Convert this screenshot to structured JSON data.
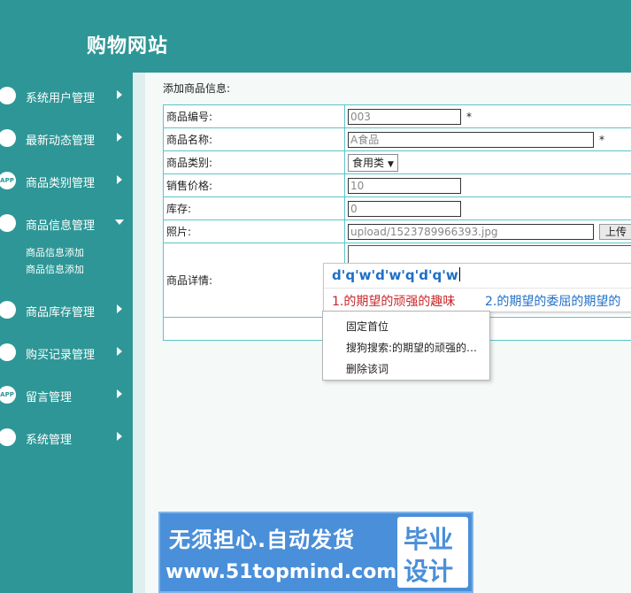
{
  "header": {
    "site_title": "购物网站"
  },
  "sidebar": {
    "items": [
      {
        "label": "系统用户管理",
        "icon": "monitor-icon",
        "icon_text": ""
      },
      {
        "label": "最新动态管理",
        "icon": "user-gear-icon",
        "icon_text": ""
      },
      {
        "label": "商品类别管理",
        "icon": "app-icon",
        "icon_text": "APP"
      },
      {
        "label": "商品信息管理",
        "icon": "cloud-icon",
        "icon_text": "",
        "expanded": true,
        "sub_items": [
          "商品信息添加",
          "商品信息添加"
        ]
      },
      {
        "label": "商品库存管理",
        "icon": "gear-icon",
        "icon_text": ""
      },
      {
        "label": "购买记录管理",
        "icon": "stack-icon",
        "icon_text": ""
      },
      {
        "label": "留言管理",
        "icon": "app-icon",
        "icon_text": "APP"
      },
      {
        "label": "系统管理",
        "icon": "bar-chart-icon",
        "icon_text": ""
      }
    ]
  },
  "form": {
    "title": "添加商品信息:",
    "fields": [
      {
        "label": "商品编号:",
        "value": "003",
        "required": "*"
      },
      {
        "label": "商品名称:",
        "value": "A食品",
        "required": "*"
      },
      {
        "label": "商品类别:",
        "value": "食用类"
      },
      {
        "label": "销售价格:",
        "value": "10"
      },
      {
        "label": "库存:",
        "value": "0"
      },
      {
        "label": "照片:",
        "value": "upload/1523789966393.jpg",
        "button": "上传"
      },
      {
        "label": "商品详情:",
        "value": ""
      }
    ]
  },
  "ime": {
    "input": "d'q'w'd'w'q'd'q'w",
    "candidates": [
      "1.的期望的顽强的趣味",
      "2.的期望的委屈的期望的"
    ],
    "menu": [
      "固定首位",
      "搜狗搜索:的期望的顽强的…",
      "删除该词"
    ]
  },
  "banner": {
    "line1": "无须担心.自动发货",
    "line2": "www.51topmind.com",
    "badge_line1": "毕业",
    "badge_line2": "设计"
  },
  "colors": {
    "teal": "#2e9696",
    "table_border": "#5bc4c9",
    "ime_blue": "#1f6fc7",
    "ime_red": "#c8262a",
    "banner_blue": "#4a8fd9"
  }
}
